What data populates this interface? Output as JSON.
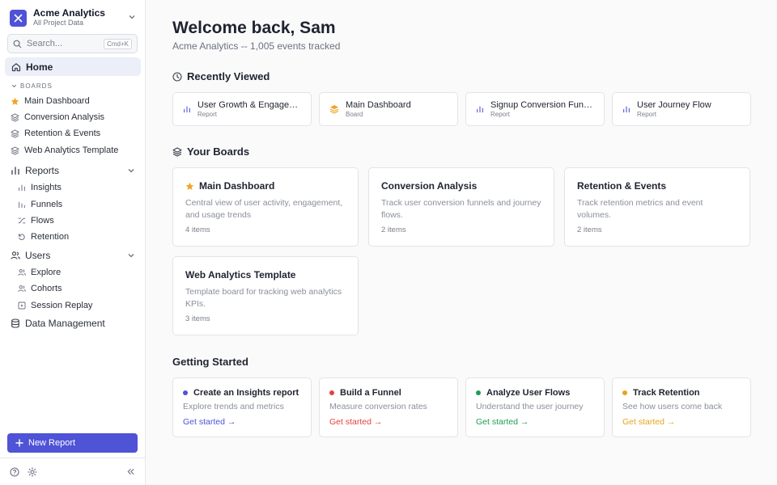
{
  "org": {
    "name": "Acme Analytics",
    "subtitle": "All Project Data"
  },
  "search": {
    "placeholder": "Search...",
    "shortcut": "Cmd+K"
  },
  "sidebar": {
    "home": "Home",
    "boards_header": "BOARDS",
    "boards": [
      "Main Dashboard",
      "Conversion Analysis",
      "Retention & Events",
      "Web Analytics Template"
    ],
    "reports": {
      "label": "Reports",
      "items": [
        "Insights",
        "Funnels",
        "Flows",
        "Retention"
      ]
    },
    "users": {
      "label": "Users",
      "items": [
        "Explore",
        "Cohorts",
        "Session Replay"
      ]
    },
    "data_management": "Data Management",
    "new_report": "New Report"
  },
  "main": {
    "title": "Welcome back, Sam",
    "subtitle": "Acme Analytics -- 1,005 events tracked",
    "recently_viewed": {
      "heading": "Recently Viewed",
      "items": [
        {
          "title": "User Growth & Engagement",
          "type": "Report",
          "icon": "bar-chart-icon"
        },
        {
          "title": "Main Dashboard",
          "type": "Board",
          "icon": "layers-icon"
        },
        {
          "title": "Signup Conversion Funnel",
          "type": "Report",
          "icon": "bar-chart-icon"
        },
        {
          "title": "User Journey Flow",
          "type": "Report",
          "icon": "bar-chart-icon"
        }
      ]
    },
    "your_boards": {
      "heading": "Your Boards",
      "items": [
        {
          "title": "Main Dashboard",
          "desc": "Central view of user activity, engagement, and usage trends",
          "count": "4 items",
          "starred": true
        },
        {
          "title": "Conversion Analysis",
          "desc": "Track user conversion funnels and journey flows.",
          "count": "2 items",
          "starred": false
        },
        {
          "title": "Retention & Events",
          "desc": "Track retention metrics and event volumes.",
          "count": "2 items",
          "starred": false
        },
        {
          "title": "Web Analytics Template",
          "desc": "Template board for tracking web analytics KPIs.",
          "count": "3 items",
          "starred": false
        }
      ]
    },
    "getting_started": {
      "heading": "Getting Started",
      "items": [
        {
          "title": "Create an Insights report",
          "desc": "Explore trends and metrics",
          "link": "Get started →",
          "color": "#4f53d6"
        },
        {
          "title": "Build a Funnel",
          "desc": "Measure conversion rates",
          "link": "Get started →",
          "color": "#e0443e"
        },
        {
          "title": "Analyze User Flows",
          "desc": "Understand the user journey",
          "link": "Get started →",
          "color": "#1f9d55"
        },
        {
          "title": "Track Retention",
          "desc": "See how users come back",
          "link": "Get started →",
          "color": "#e8a31c"
        }
      ]
    }
  },
  "colors": {
    "accent": "#4f53d6",
    "star": "#f0a52a",
    "home_bg": "#eceef8"
  }
}
